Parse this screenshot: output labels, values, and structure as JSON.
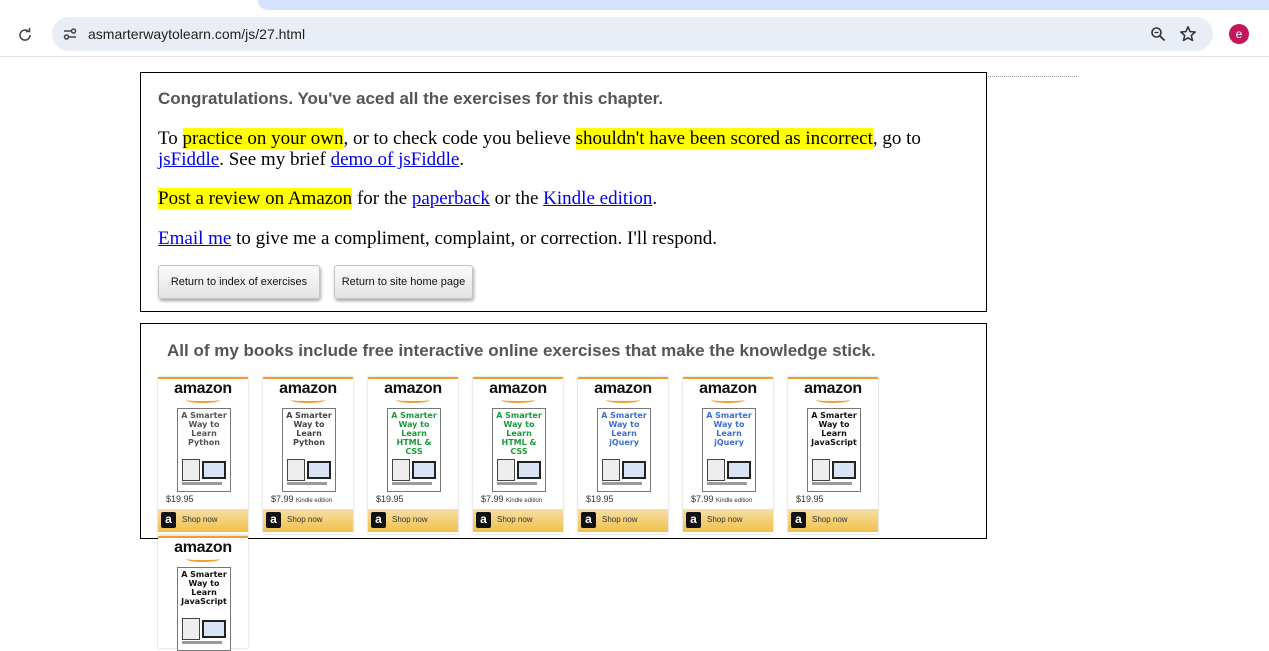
{
  "browser": {
    "url": "asmarterwaytolearn.com/js/27.html",
    "avatar_letter": "e"
  },
  "panel": {
    "heading": "Congratulations. You've aced all the exercises for this chapter.",
    "p1": {
      "t1": "To ",
      "hl1": "practice on your own",
      "t2": ", or to check code you believe ",
      "hl2": "shouldn't have been scored as incorrect",
      "t3": ", go to ",
      "link1": "jsFiddle",
      "t4": ". See my brief ",
      "link2": "demo of jsFiddle",
      "t5": "."
    },
    "p2": {
      "hl": "Post a review on Amazon",
      "t1": " for the ",
      "link1": "paperback",
      "t2": " or the ",
      "link2": "Kindle edition",
      "t3": "."
    },
    "p3": {
      "link": "Email me",
      "t1": " to give me a compliment, complaint, or correction. I'll respond."
    },
    "buttons": {
      "index": "Return to index of exercises",
      "home": "Return to site home page"
    }
  },
  "books": {
    "heading": "All of my books include free interactive online exercises that make the knowledge stick.",
    "ads": [
      {
        "logo": "amazon",
        "cover_title": "A Smarter Way to Learn Python",
        "price": "$19.95",
        "kindle": "",
        "shop": "Shop now",
        "color": "#555555"
      },
      {
        "logo": "amazon",
        "cover_title": "A Smarter Way to Learn Python",
        "price": "$7.99",
        "kindle": "Kindle edition",
        "shop": "Shop now",
        "color": "#444444"
      },
      {
        "logo": "amazon",
        "cover_title": "A Smarter Way to Learn HTML & CSS",
        "price": "$19.95",
        "kindle": "",
        "shop": "Shop now",
        "color": "#1a9b3a"
      },
      {
        "logo": "amazon",
        "cover_title": "A Smarter Way to Learn HTML & CSS",
        "price": "$7.99",
        "kindle": "Kindle edition",
        "shop": "Shop now",
        "color": "#1a9b3a"
      },
      {
        "logo": "amazon",
        "cover_title": "A Smarter Way to Learn jQuery",
        "price": "$19.95",
        "kindle": "",
        "shop": "Shop now",
        "color": "#3b6fd6"
      },
      {
        "logo": "amazon",
        "cover_title": "A Smarter Way to Learn jQuery",
        "price": "$7.99",
        "kindle": "Kindle edition",
        "shop": "Shop now",
        "color": "#3b6fd6"
      },
      {
        "logo": "amazon",
        "cover_title": "A Smarter Way to Learn JavaScript",
        "price": "$19.95",
        "kindle": "",
        "shop": "Shop now",
        "color": "#111111"
      },
      {
        "logo": "amazon",
        "cover_title": "A Smarter Way to Learn JavaScript",
        "price": "",
        "kindle": "",
        "shop": "",
        "color": "#111111"
      }
    ]
  },
  "icons": [
    "reload-icon",
    "site-info-icon",
    "zoom-icon",
    "bookmark-star-icon"
  ]
}
